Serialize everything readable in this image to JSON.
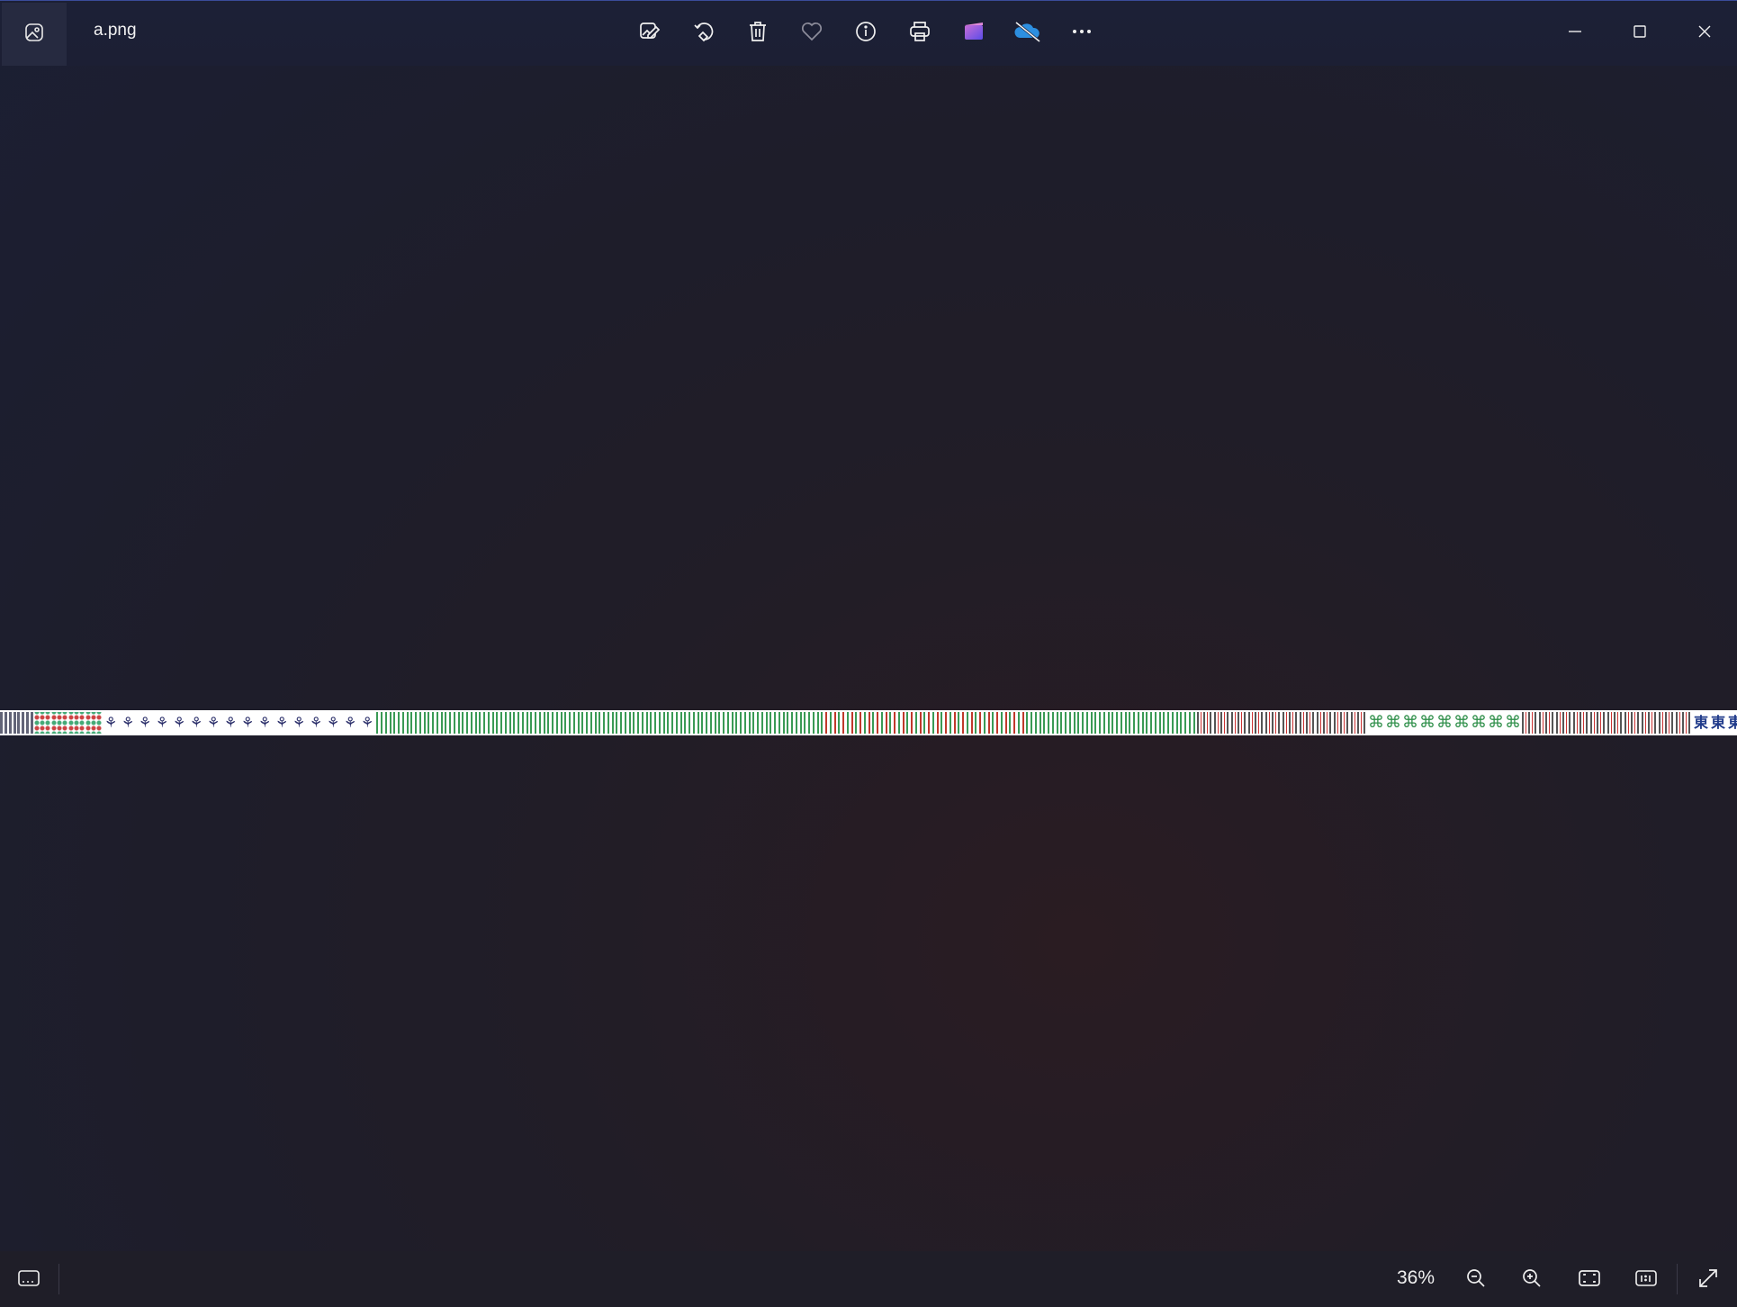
{
  "window": {
    "file_name": "a.png"
  },
  "toolbar": {
    "items": [
      {
        "name": "edit-image",
        "icon": "edit-image-icon"
      },
      {
        "name": "rotate",
        "icon": "rotate-icon"
      },
      {
        "name": "delete",
        "icon": "trash-icon"
      },
      {
        "name": "favorite",
        "icon": "heart-icon"
      },
      {
        "name": "file-info",
        "icon": "info-icon"
      },
      {
        "name": "print",
        "icon": "printer-icon"
      },
      {
        "name": "clipchamp",
        "icon": "clipchamp-icon"
      },
      {
        "name": "onedrive",
        "icon": "onedrive-icon"
      },
      {
        "name": "see-more",
        "icon": "more-icon"
      }
    ]
  },
  "window_controls": {
    "minimize": "minimize-icon",
    "maximize": "maximize-icon",
    "close": "close-icon"
  },
  "status_bar": {
    "zoom_level": "36%"
  },
  "image": {
    "description_kind": "mahjong tile sprite strip",
    "east_glyph": "東"
  },
  "colors": {
    "accent_onedrive": "#2d8fe0",
    "accent_clipchamp": "#8a4df0",
    "background": "#1e1d2a"
  }
}
